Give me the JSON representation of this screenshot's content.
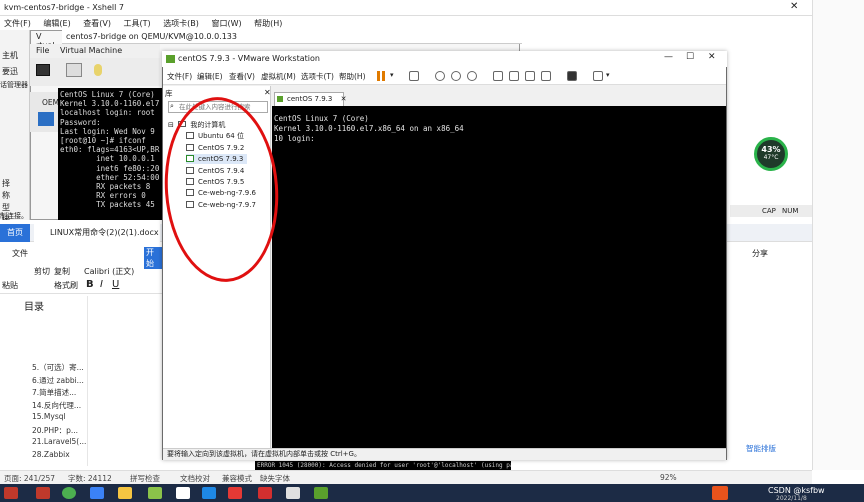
{
  "xshell": {
    "title": "kvm-centos7-bridge - Xshell 7",
    "menu": [
      "文件(F)",
      "编辑(E)",
      "查看(V)",
      "工具(T)",
      "选项卡(B)",
      "窗口(W)",
      "帮助(H)"
    ],
    "side_labels": [
      "主机",
      "要迅",
      "话管理器",
      "择",
      "称",
      "型",
      "接",
      "注",
      "制连接。"
    ],
    "status": {
      "caps": "CAP",
      "num": "NUM"
    }
  },
  "qemu": {
    "title": "centos7-bridge on QEMU/KVM@10.0.0.133",
    "back_title": "V rtual",
    "menu": [
      "File",
      "Virtual Machine"
    ],
    "sidebar_label": "OEM",
    "terminal_lines": [
      "CentOS Linux 7 (Core)",
      "Kernel 3.10.0-1160.el7",
      "",
      "localhost login: root",
      "Password:",
      "Last login: Wed Nov 9",
      "[root@10 ~]# ifconf",
      "eth0: flags=4163<UP,BR",
      "        inet 10.0.0.1",
      "        inet6 fe80::20",
      "        ether 52:54:00",
      "        RX packets 8",
      "        RX errors 0",
      "        TX packets 45"
    ]
  },
  "vmware": {
    "title": "centOS 7.9.3 - VMware Workstation",
    "menu": [
      "文件(F)",
      "编辑(E)",
      "查看(V)",
      "虚拟机(M)",
      "选项卡(T)",
      "帮助(H)"
    ],
    "library_title": "库",
    "search_placeholder": "在此处键入内容进行搜索",
    "tree_root": "我的计算机",
    "vms": [
      "Ubuntu 64 位",
      "CentOS 7.9.2",
      "centOS 7.9.3",
      "CentOS 7.9.4",
      "CentOS 7.9.5",
      "Ce-web-ng-7.9.6",
      "Ce-web-ng-7.9.7"
    ],
    "selected_vm_index": 2,
    "active_tab": "centOS 7.9.3",
    "console_lines": [
      "CentOS Linux 7 (Core)",
      "Kernel 3.10.0-1160.el7.x86_64 on an x86_64",
      "",
      "10 login:"
    ],
    "status_text": "要将输入定向到该虚拟机，请在虚拟机内部单击或按 Ctrl+G。"
  },
  "mysql_error": "ERROR 1045 (28000): Access denied for user 'root'@'localhost' (using password: YES)",
  "wps": {
    "home_tab": "首页",
    "doc_tab": "LINUX常用命令(2)(2(1).docx",
    "file_menu": "文件",
    "open_label": "开始",
    "ribbon": {
      "cut": "剪切",
      "copy": "复制",
      "format_painter": "格式刷",
      "paste": "粘贴",
      "font": "Calibri (正文)"
    },
    "toc_title": "目录",
    "toc_items": [
      "5.（可选）寄...",
      "6.通过 zabbi...",
      "7.简单描述...",
      "14.反向代理...",
      "15.Mysql",
      "20.PHP：p...",
      "21.Laravel5(...",
      "28.Zabbix"
    ],
    "share": "分享",
    "smart_layout": "智能排版",
    "statusbar": {
      "page": "页面: 241/257",
      "words": "字数: 24112",
      "spell": "拼写检查",
      "proof": "文档校对",
      "compat": "兼容模式",
      "missing_font": "缺失字体",
      "zoom": "92%"
    }
  },
  "gauge": {
    "percent": "43%",
    "temp": "47°C"
  },
  "taskbar": {
    "watermark": "CSDN @ksfbw",
    "date": "2022/11/8"
  }
}
